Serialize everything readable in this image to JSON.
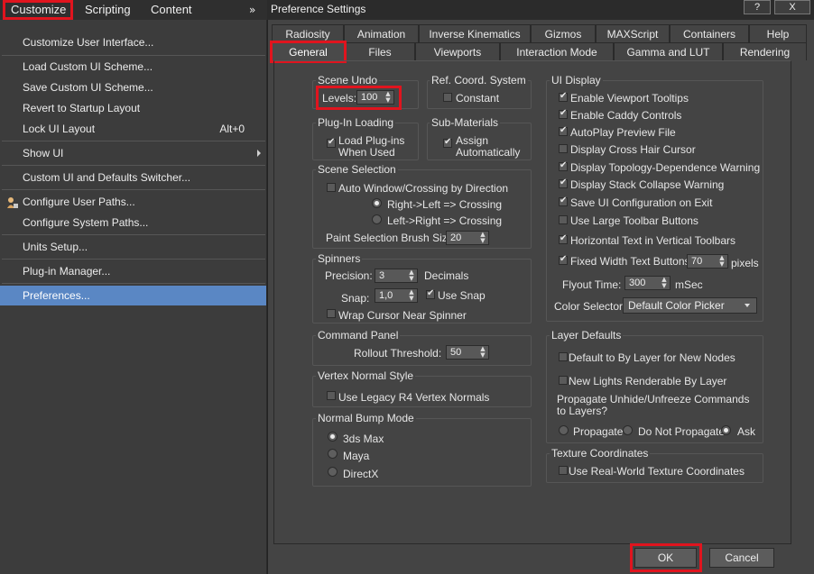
{
  "menubar": {
    "items": [
      "Customize",
      "Scripting",
      "Content"
    ],
    "overflow": "»"
  },
  "menu": {
    "items": [
      {
        "label": "Customize User Interface...",
        "accel": ""
      },
      {
        "label": "Load Custom UI Scheme...",
        "accel": ""
      },
      {
        "label": "Save Custom UI Scheme...",
        "accel": ""
      },
      {
        "label": "Revert to Startup Layout",
        "accel": ""
      },
      {
        "label": "Lock UI Layout",
        "accel": "Alt+0"
      },
      {
        "label": "Show UI",
        "accel": ""
      },
      {
        "label": "Custom UI and Defaults Switcher...",
        "accel": ""
      },
      {
        "label": "Configure User Paths...",
        "accel": ""
      },
      {
        "label": "Configure System Paths...",
        "accel": ""
      },
      {
        "label": "Units Setup...",
        "accel": ""
      },
      {
        "label": "Plug-in Manager...",
        "accel": ""
      },
      {
        "label": "Preferences...",
        "accel": ""
      }
    ]
  },
  "dialog": {
    "title": "Preference Settings",
    "help_btn": "?",
    "close_btn": "X",
    "tabs_row1": [
      "Radiosity",
      "Animation",
      "Inverse Kinematics",
      "Gizmos",
      "MAXScript",
      "Containers",
      "Help"
    ],
    "tabs_row2": [
      "General",
      "Files",
      "Viewports",
      "Interaction Mode",
      "Gamma and LUT",
      "Rendering"
    ],
    "scene_undo": {
      "title": "Scene Undo",
      "levels_label": "Levels:",
      "levels_value": "100"
    },
    "ref_coord": {
      "title": "Ref. Coord. System",
      "constant": "Constant"
    },
    "plugin_loading": {
      "title": "Plug-In Loading",
      "load_line1": "Load Plug-ins",
      "load_line2": "When Used"
    },
    "sub_materials": {
      "title": "Sub-Materials",
      "assign_line1": "Assign",
      "assign_line2": "Automatically"
    },
    "scene_selection": {
      "title": "Scene Selection",
      "auto_window": "Auto Window/Crossing by Direction",
      "right_left": "Right->Left => Crossing",
      "left_right": "Left->Right => Crossing",
      "brush_label": "Paint Selection Brush Size",
      "brush_value": "20"
    },
    "spinners": {
      "title": "Spinners",
      "precision_label": "Precision:",
      "precision_value": "3",
      "decimals": "Decimals",
      "snap_label": "Snap:",
      "snap_value": "1,0",
      "use_snap": "Use Snap",
      "wrap": "Wrap Cursor Near Spinner"
    },
    "command_panel": {
      "title": "Command Panel",
      "rollout_label": "Rollout Threshold:",
      "rollout_value": "50"
    },
    "vertex_normal": {
      "title": "Vertex Normal Style",
      "legacy": "Use Legacy R4 Vertex Normals"
    },
    "normal_bump": {
      "title": "Normal Bump Mode",
      "opt1": "3ds Max",
      "opt2": "Maya",
      "opt3": "DirectX"
    },
    "ui_display": {
      "title": "UI Display",
      "checks": [
        {
          "label": "Enable Viewport Tooltips",
          "on": true
        },
        {
          "label": "Enable Caddy Controls",
          "on": true
        },
        {
          "label": "AutoPlay Preview File",
          "on": true
        },
        {
          "label": "Display Cross Hair Cursor",
          "on": false
        },
        {
          "label": "Display Topology-Dependence Warning",
          "on": true
        },
        {
          "label": "Display Stack Collapse Warning",
          "on": true
        },
        {
          "label": "Save UI Configuration on Exit",
          "on": true
        },
        {
          "label": "Use Large Toolbar Buttons",
          "on": false
        },
        {
          "label": "Horizontal Text in Vertical Toolbars",
          "on": true
        }
      ],
      "fixed_width_label": "Fixed Width Text Buttons:",
      "fixed_width_value": "70",
      "pixels": "pixels",
      "flyout_label": "Flyout Time:",
      "flyout_value": "300",
      "msec": "mSec",
      "color_selector_label": "Color Selector:",
      "color_selector_value": "Default Color Picker"
    },
    "layer_defaults": {
      "title": "Layer Defaults",
      "default_bylayer": "Default to By Layer for New Nodes",
      "new_lights": "New Lights Renderable By Layer",
      "propagate_line1": "Propagate Unhide/Unfreeze Commands",
      "propagate_line2": "to Layers?",
      "opt_propagate": "Propagate",
      "opt_do_not": "Do Not Propagate",
      "opt_ask": "Ask"
    },
    "texture_coords": {
      "title": "Texture Coordinates",
      "real_world": "Use Real-World Texture Coordinates"
    },
    "ok": "OK",
    "cancel": "Cancel"
  },
  "colors": {
    "highlight": "#5a87c4",
    "annotation_red": "#e0141e",
    "dialog_bg": "#444444"
  }
}
